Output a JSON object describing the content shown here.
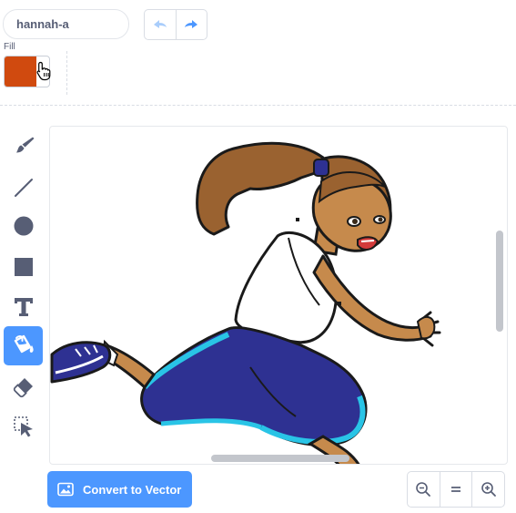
{
  "costume": {
    "name": "hannah-a"
  },
  "history": {
    "undo_icon": "undo-icon",
    "redo_icon": "redo-icon"
  },
  "fill": {
    "label": "Fill",
    "color": "#d04a0f"
  },
  "tools": [
    {
      "name": "brush",
      "icon": "brush-icon"
    },
    {
      "name": "line",
      "icon": "line-icon"
    },
    {
      "name": "circle",
      "icon": "circle-icon"
    },
    {
      "name": "rectangle",
      "icon": "rectangle-icon"
    },
    {
      "name": "text",
      "icon": "text-icon",
      "glyph": "T"
    },
    {
      "name": "fill",
      "icon": "fill-bucket-icon",
      "active": true
    },
    {
      "name": "eraser",
      "icon": "eraser-icon"
    },
    {
      "name": "select",
      "icon": "select-icon"
    }
  ],
  "canvas": {
    "image": "hannah-running-sprite"
  },
  "actions": {
    "convert_label": "Convert to Vector"
  },
  "zoom": {
    "zoom_out_icon": "zoom-out-icon",
    "reset_icon": "zoom-reset-icon",
    "zoom_in_icon": "zoom-in-icon"
  },
  "colors": {
    "accent": "#4c97ff",
    "text": "#575e75",
    "tool_icon": "#575e75"
  }
}
